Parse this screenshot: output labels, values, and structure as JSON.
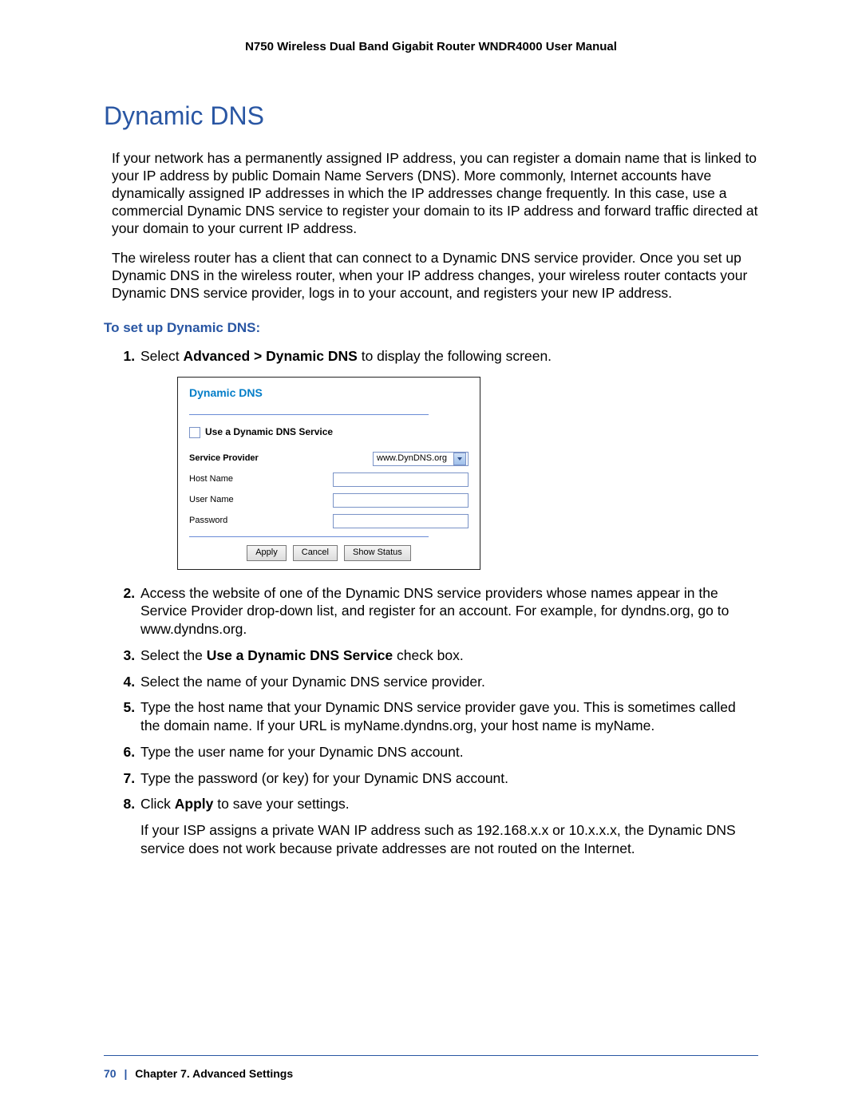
{
  "header": {
    "title": "N750 Wireless Dual Band Gigabit Router WNDR4000 User Manual"
  },
  "page_title": "Dynamic DNS",
  "intro": {
    "p1": "If your network has a permanently assigned IP address, you can register a domain name that is linked to your IP address by public Domain Name Servers (DNS). More commonly, Internet accounts have dynamically assigned IP addresses in which the IP addresses change frequently. In this case, use a commercial Dynamic DNS service to register your domain to its IP address and forward traffic directed at your domain to your current IP address.",
    "p2": "The wireless router has a client that can connect to a Dynamic DNS service provider. Once you set up Dynamic DNS in the wireless router, when your IP address changes, your wireless router contacts your Dynamic DNS service provider, logs in to your account, and registers your new IP address."
  },
  "subhead": "To set up Dynamic DNS:",
  "steps": {
    "s1_a": "Select ",
    "s1_b": "Advanced > Dynamic DNS",
    "s1_c": " to display the following screen.",
    "s2": "Access the website of one of the Dynamic DNS service providers whose names appear in the Service Provider drop-down list, and register for an account. For example, for dyndns.org, go to www.dyndns.org.",
    "s3_a": "Select the ",
    "s3_b": "Use a Dynamic DNS Service",
    "s3_c": " check box.",
    "s4": "Select the name of your Dynamic DNS service provider.",
    "s5": "Type the host name that your Dynamic DNS service provider gave you. This is sometimes called the domain name. If your URL is myName.dyndns.org, your host name is myName.",
    "s6": "Type the user name for your Dynamic DNS account.",
    "s7": "Type the password (or key) for your Dynamic DNS account.",
    "s8_a": "Click ",
    "s8_b": "Apply",
    "s8_c": " to save your settings.",
    "after8": "If your ISP assigns a private WAN IP address such as 192.168.x.x or 10.x.x.x, the Dynamic DNS service does not work because private addresses are not routed on the Internet."
  },
  "screenshot": {
    "title": "Dynamic DNS",
    "checkbox_label": "Use a Dynamic DNS Service",
    "fields": {
      "service_provider": {
        "label": "Service Provider",
        "value": "www.DynDNS.org"
      },
      "host_name": {
        "label": "Host Name",
        "value": ""
      },
      "user_name": {
        "label": "User Name",
        "value": ""
      },
      "password": {
        "label": "Password",
        "value": ""
      }
    },
    "buttons": {
      "apply": "Apply",
      "cancel": "Cancel",
      "show_status": "Show Status"
    }
  },
  "footer": {
    "page_number": "70",
    "separator": "|",
    "chapter": "Chapter 7.  Advanced Settings"
  }
}
